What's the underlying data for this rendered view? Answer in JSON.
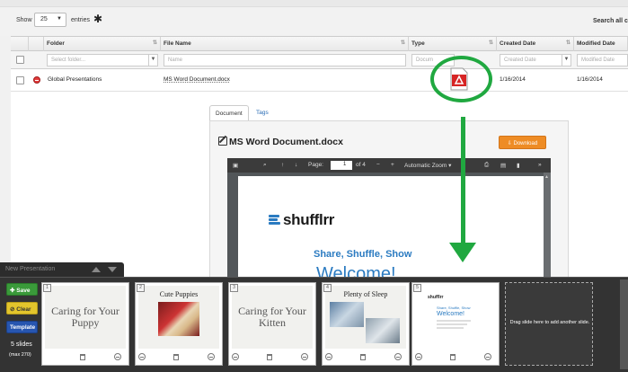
{
  "toolbar": {
    "show_label": "Show",
    "entries_value": "25",
    "entries_label": "entries",
    "search_label": "Search all c"
  },
  "table": {
    "columns": [
      "Folder",
      "File Name",
      "Type",
      "Created Date",
      "Modified Date"
    ],
    "filters": {
      "folder_placeholder": "Select folder...",
      "name_placeholder": "Name",
      "type_placeholder": "Docum",
      "created_placeholder": "Created Date",
      "modified_placeholder": "Modified Date"
    },
    "rows": [
      {
        "folder": "Global Presentations",
        "file_name": "MS Word Document.docx",
        "created": "1/16/2014",
        "modified": "1/16/2014"
      }
    ]
  },
  "detail": {
    "tab_document": "Document",
    "tab_tags": "Tags",
    "title": "MS Word Document.docx",
    "download_label": "Download"
  },
  "viewer": {
    "page_label": "Page:",
    "page_current": "1",
    "page_total": "of 4",
    "zoom_label": "Automatic Zoom",
    "zoom_minus": "−",
    "zoom_plus": "+"
  },
  "pdf_content": {
    "logo": "shufflrr",
    "tagline": "Share, Shuffle, Show",
    "welcome": "Welcome!"
  },
  "presentation_tray": {
    "title": "New Presentation",
    "save_label": "Save",
    "clear_label": "Clear",
    "template_label": "Template",
    "slides_count": "5 slides",
    "slides_max": "(max 270)",
    "drop_hint": "Drag slide here to add another slide.",
    "slides": [
      {
        "num": "1",
        "text": "Caring for Your Puppy"
      },
      {
        "num": "2",
        "text": "Cute Puppies"
      },
      {
        "num": "3",
        "text": "Caring for Your Kitten"
      },
      {
        "num": "4",
        "text": "Plenty of Sleep"
      },
      {
        "num": "5",
        "text": "shufflrr",
        "sub": "Share, Shuffle, Show",
        "welcome": "Welcome!"
      }
    ]
  },
  "colors": {
    "accent_green": "#20a840",
    "download_orange": "#ee8c25",
    "brand_blue": "#2b7bc1",
    "tray_dark": "#333333"
  }
}
